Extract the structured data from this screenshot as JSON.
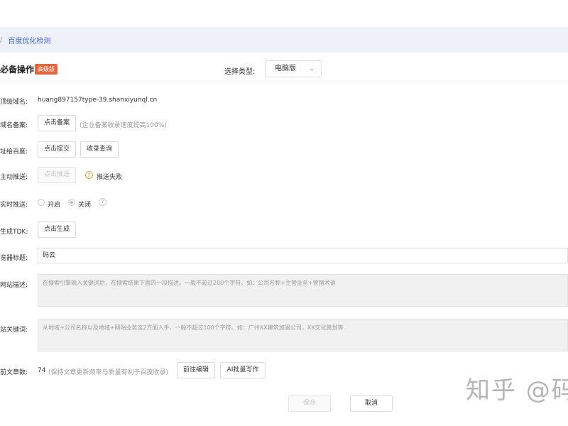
{
  "breadcrumb": {
    "separator": "/",
    "current": "百度优化检测"
  },
  "section": {
    "title": "必备操作",
    "badge": "高级版"
  },
  "type_select": {
    "label": "选择类型:",
    "value": "电脑版"
  },
  "rows": {
    "domain": {
      "label": "顶级域名:",
      "value": "huang897157type-39.shanxiyunql.cn"
    },
    "icp": {
      "label": "域名备案:",
      "button": "点击备案",
      "hint": "(企业备案收录速度提高100%)"
    },
    "submit": {
      "label": "址给百度:",
      "button1": "点击提交",
      "button2": "收录查询"
    },
    "push": {
      "label": "主动推送:",
      "button": "点击推送",
      "status": "推送失败"
    },
    "realtime": {
      "label": "实时推送:",
      "on": "开启",
      "off": "关闭",
      "help": "?"
    },
    "tdk": {
      "label": "生成TDK:",
      "button": "点击生成"
    },
    "browser_title": {
      "label": "览器标题:",
      "value": "码云"
    },
    "description": {
      "label": "网站描述:",
      "placeholder": "在搜索引擎输入关键词后，在搜索结果下面的一段描述。一般不超过200个字符。如：公司名称+主营业务+营销术语"
    },
    "keywords": {
      "label": "站关键词:",
      "placeholder": "从地域+公司名称以及地域+网站业务这2方面入手，一般不超过100个字符。如：广州XX建筑加固公司，XX文化策划等"
    },
    "articles": {
      "label": "前文章数:",
      "count": "74",
      "hint": "(保持文章更新频率与质量有利于百度收录)",
      "button1": "前往编辑",
      "button2": "AI批量写作"
    }
  },
  "footer": {
    "save": "保存",
    "cancel": "取消"
  },
  "watermark": "知乎 @码"
}
